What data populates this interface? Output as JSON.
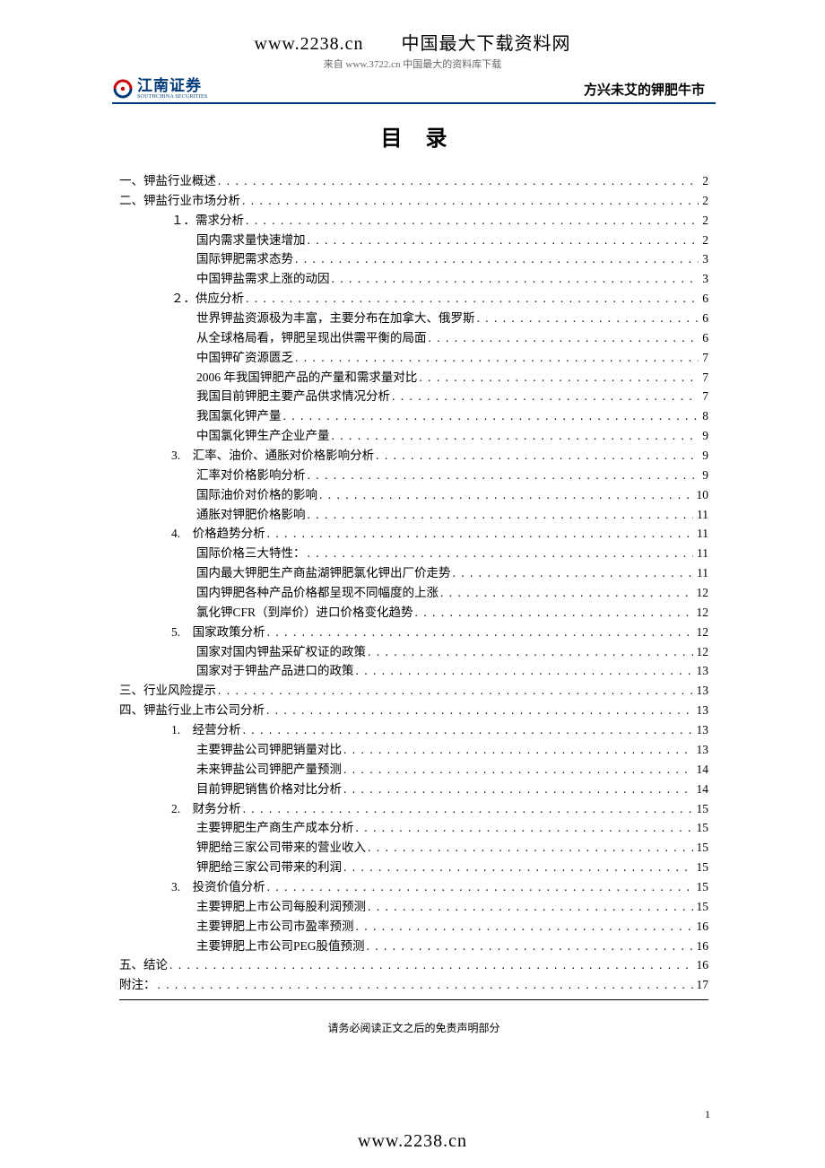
{
  "header": {
    "top_line": "www.2238.cn　　中国最大下载资料网",
    "sub_line": "来自 www.3722.cn 中国最大的资料库下载"
  },
  "logo": {
    "cn": "江南证券",
    "en": "SOUTHCHINA SECURITIES"
  },
  "doc_title": "方兴未艾的钾肥牛市",
  "toc_heading": "目录",
  "toc": [
    {
      "level": 0,
      "label": "一、钾盐行业概述",
      "page": "2"
    },
    {
      "level": 0,
      "label": "二、钾盐行业市场分析",
      "page": "2"
    },
    {
      "level": 1,
      "label": "１．需求分析",
      "page": "2"
    },
    {
      "level": 2,
      "label": "国内需求量快速增加",
      "page": "2"
    },
    {
      "level": 2,
      "label": "国际钾肥需求态势",
      "page": "3"
    },
    {
      "level": 2,
      "label": "中国钾盐需求上涨的动因",
      "page": "3"
    },
    {
      "level": 1,
      "label": "２．供应分析",
      "page": "6"
    },
    {
      "level": 2,
      "label": "世界钾盐资源极为丰富，主要分布在加拿大、俄罗斯",
      "page": "6"
    },
    {
      "level": 2,
      "label": "从全球格局看，钾肥呈现出供需平衡的局面",
      "page": "6"
    },
    {
      "level": 2,
      "label": "中国钾矿资源匮乏",
      "page": "7"
    },
    {
      "level": 2,
      "label": "2006 年我国钾肥产品的产量和需求量对比",
      "page": "7"
    },
    {
      "level": 2,
      "label": "我国目前钾肥主要产品供求情况分析",
      "page": "7"
    },
    {
      "level": 2,
      "label": "我国氯化钾产量",
      "page": "8"
    },
    {
      "level": 2,
      "label": "中国氯化钾生产企业产量",
      "page": "9"
    },
    {
      "level": 1,
      "label": "3.　汇率、油价、通胀对价格影响分析",
      "page": "9"
    },
    {
      "level": 2,
      "label": "汇率对价格影响分析",
      "page": "9"
    },
    {
      "level": 2,
      "label": "国际油价对价格的影响",
      "page": "10"
    },
    {
      "level": 2,
      "label": "通胀对钾肥价格影响",
      "page": "11"
    },
    {
      "level": 1,
      "label": "4.　价格趋势分析",
      "page": "11"
    },
    {
      "level": 2,
      "label": "国际价格三大特性：",
      "page": "11"
    },
    {
      "level": 2,
      "label": "国内最大钾肥生产商盐湖钾肥氯化钾出厂价走势",
      "page": "11"
    },
    {
      "level": 2,
      "label": "国内钾肥各种产品价格都呈现不同幅度的上涨",
      "page": "12"
    },
    {
      "level": 2,
      "label": "氯化钾CFR（到岸价）进口价格变化趋势",
      "page": "12"
    },
    {
      "level": 1,
      "label": "5.　国家政策分析",
      "page": "12"
    },
    {
      "level": 2,
      "label": "国家对国内钾盐采矿权证的政策",
      "page": "12"
    },
    {
      "level": 2,
      "label": "国家对于钾盐产品进口的政策",
      "page": "13"
    },
    {
      "level": 0,
      "label": "三、行业风险提示",
      "page": "13"
    },
    {
      "level": 0,
      "label": "四、钾盐行业上市公司分析",
      "page": "13"
    },
    {
      "level": 1,
      "label": "1.　经营分析",
      "page": "13"
    },
    {
      "level": 2,
      "label": "主要钾盐公司钾肥销量对比",
      "page": "13"
    },
    {
      "level": 2,
      "label": "未来钾盐公司钾肥产量预测",
      "page": "14"
    },
    {
      "level": 2,
      "label": "目前钾肥销售价格对比分析",
      "page": "14"
    },
    {
      "level": 1,
      "label": "2.　财务分析",
      "page": "15"
    },
    {
      "level": 2,
      "label": "主要钾肥生产商生产成本分析",
      "page": "15"
    },
    {
      "level": 2,
      "label": "钾肥给三家公司带来的营业收入",
      "page": "15"
    },
    {
      "level": 2,
      "label": "钾肥给三家公司带来的利润",
      "page": "15"
    },
    {
      "level": 1,
      "label": "3.　投资价值分析",
      "page": "15"
    },
    {
      "level": 2,
      "label": "主要钾肥上市公司每股利润预测",
      "page": "15"
    },
    {
      "level": 2,
      "label": "主要钾肥上市公司市盈率预测",
      "page": "16"
    },
    {
      "level": 2,
      "label": "主要钾肥上市公司PEG股值预测",
      "page": "16"
    },
    {
      "level": 0,
      "label": "五、结论",
      "page": "16"
    },
    {
      "level": 0,
      "label": "附注：",
      "page": "17"
    }
  ],
  "disclaimer": "请务必阅读正文之后的免责声明部分",
  "page_number": "1",
  "footer_url": "www.2238.cn"
}
